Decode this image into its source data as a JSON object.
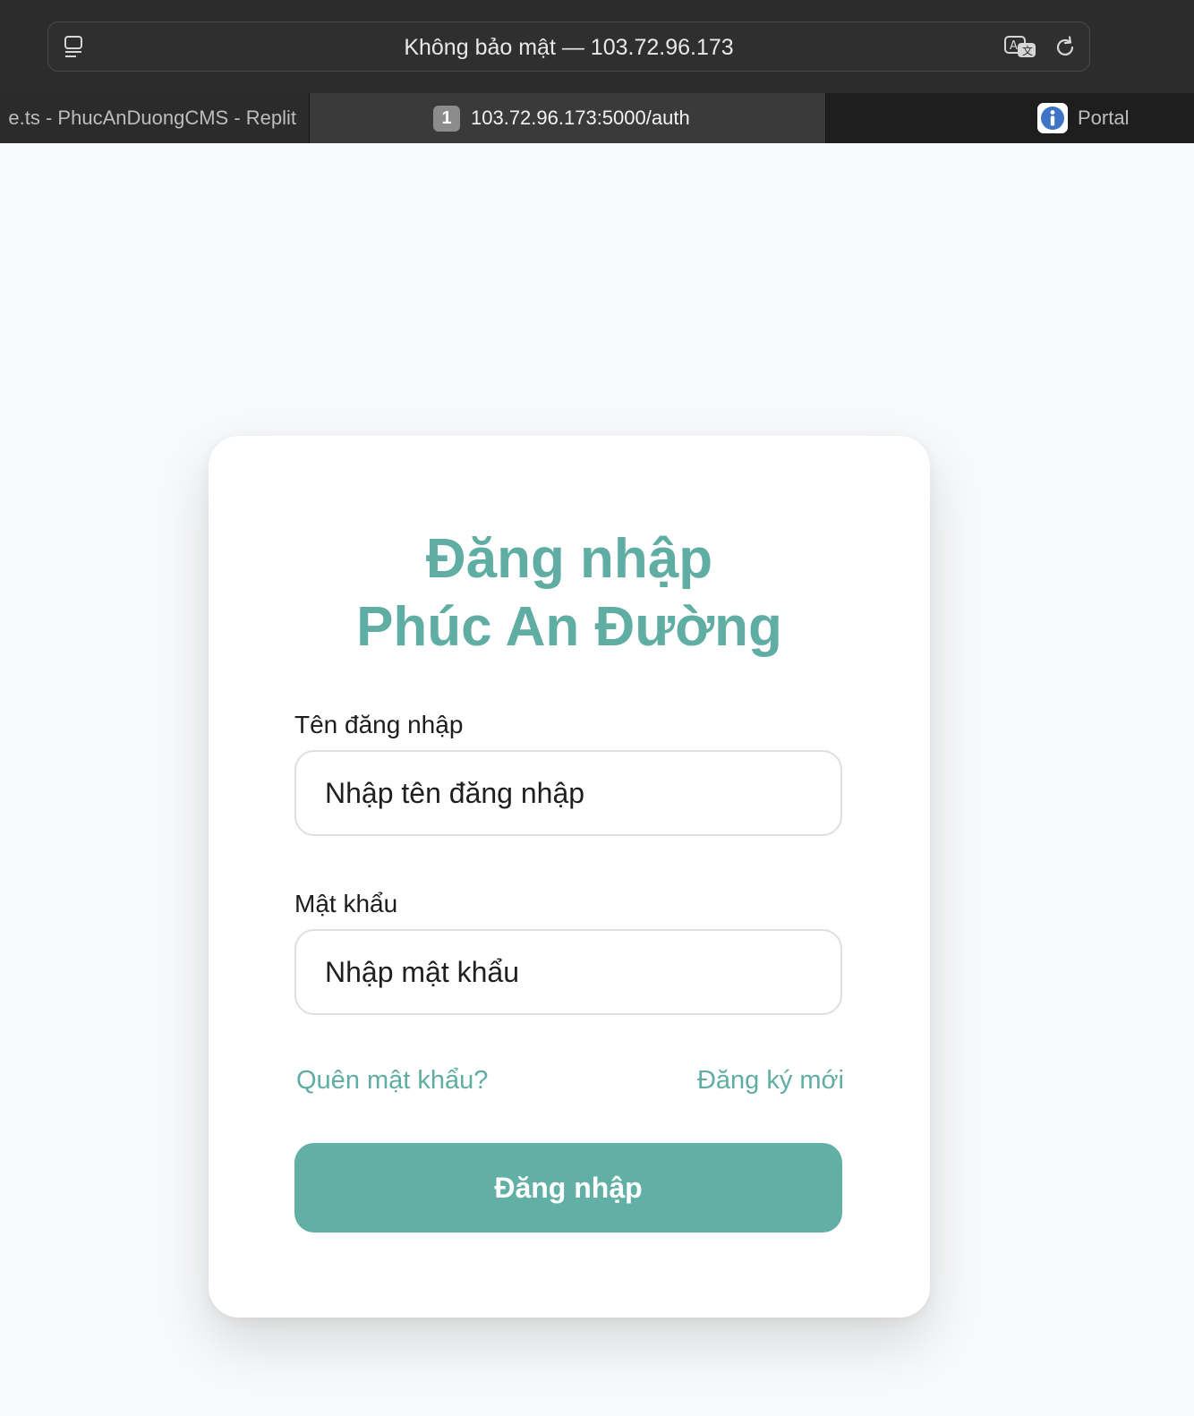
{
  "browser": {
    "address_text": "Không bảo mật — 103.72.96.173",
    "icons": {
      "reader": "sidebar-icon",
      "translate": "translate-icon",
      "reload": "reload-icon"
    },
    "tabs": [
      {
        "label": "e.ts - PhucAnDuongCMS - Replit",
        "active": false
      },
      {
        "label": "103.72.96.173:5000/auth",
        "active": true,
        "badge": "1"
      },
      {
        "label": "Portal",
        "active": false,
        "icon": "info-icon"
      }
    ]
  },
  "login": {
    "title_line1": "Đăng nhập",
    "title_line2": "Phúc An Đường",
    "username": {
      "label": "Tên đăng nhập",
      "placeholder": "Nhập tên đăng nhập",
      "value": ""
    },
    "password": {
      "label": "Mật khẩu",
      "placeholder": "Nhập mật khẩu",
      "value": ""
    },
    "forgot_link": "Quên mật khẩu?",
    "register_link": "Đăng ký mới",
    "submit_label": "Đăng nhập"
  },
  "colors": {
    "accent": "#5fada3",
    "button": "#62afa6",
    "page_bg": "#f8f9fa",
    "chrome_bg": "#2c2c2c"
  }
}
